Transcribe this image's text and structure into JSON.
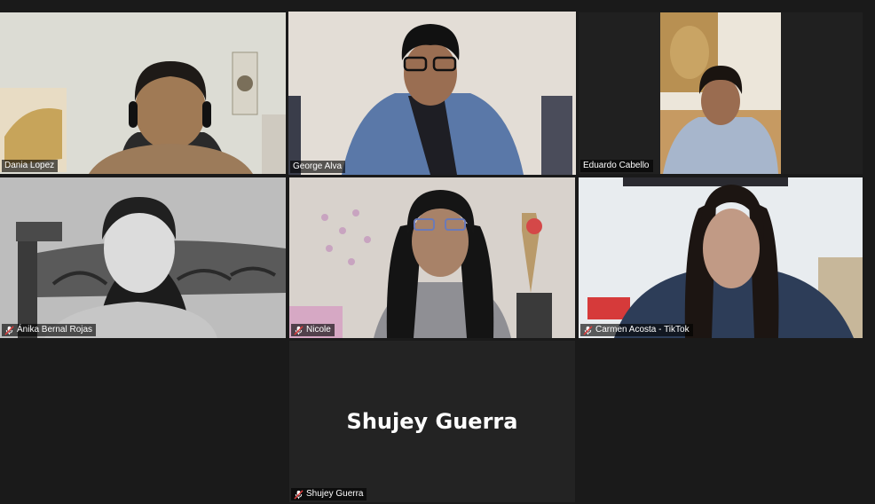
{
  "participants": [
    {
      "name": "Dania Lopez",
      "muted": false,
      "active": false
    },
    {
      "name": "George Alva",
      "muted": false,
      "active": true
    },
    {
      "name": "Eduardo Cabello",
      "muted": false,
      "active": false
    },
    {
      "name": "Ánika Bernal Rojas",
      "muted": true,
      "active": false
    },
    {
      "name": "Nicole",
      "muted": true,
      "active": false
    },
    {
      "name": "Carmen Acosta - TikTok",
      "muted": true,
      "active": false
    },
    {
      "name": "Shujey Guerra",
      "muted": true,
      "active": false,
      "video_off": true
    }
  ],
  "colors": {
    "active_speaker_border": "#cfe16a",
    "muted_icon": "#e03b3b",
    "background": "#1a1a1a",
    "tile_off": "#232323"
  }
}
